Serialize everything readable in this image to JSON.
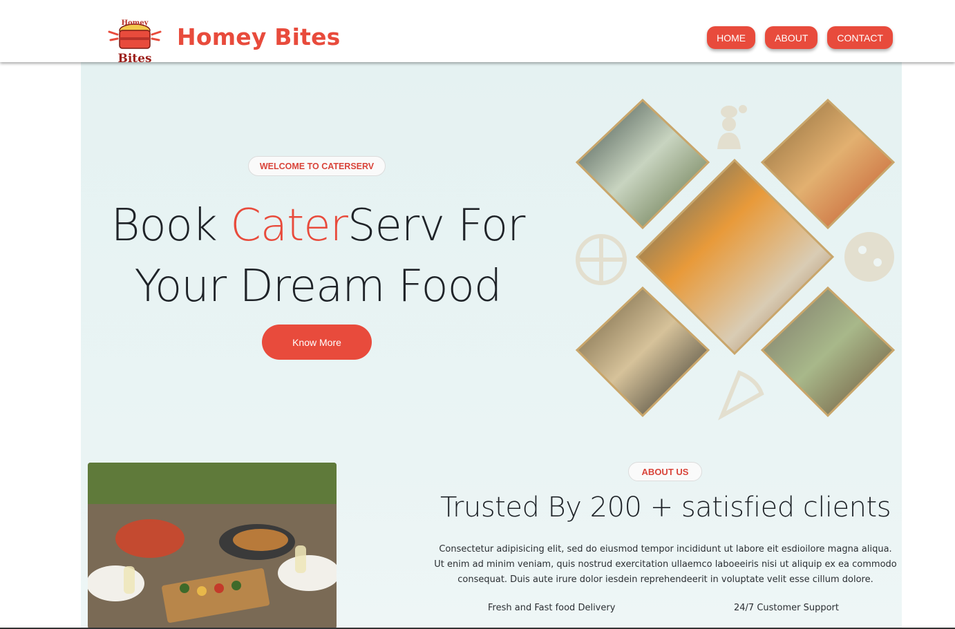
{
  "header": {
    "logo_text_top": "Homey",
    "logo_text_bottom": "Bites",
    "brand": "Homey Bites",
    "nav": [
      "HOME",
      "ABOUT",
      "CONTACT"
    ]
  },
  "hero": {
    "badge": "WELCOME TO CATERSERV",
    "title_part1": "Book ",
    "title_accent": "Cater",
    "title_part2": "Serv For",
    "title_line2": "Your Dream Food",
    "button": "Know More"
  },
  "about": {
    "badge": "ABOUT US",
    "title": "Trusted By 200 + satisfied clients",
    "text": "Consectetur adipisicing elit, sed do eiusmod tempor incididunt ut labore eit esdioilore magna aliqua. Ut enim ad minim veniam, quis nostrud exercitation ullaemco laboeeiris nisi ut aliquip ex ea commodo consequat. Duis aute irure dolor iesdein reprehendeerit in voluptate velit esse cillum dolore.",
    "features": [
      "Fresh and Fast food Delivery",
      "24/7 Customer Support"
    ]
  },
  "colors": {
    "accent": "#e84b3c",
    "panel_bg": "#e5f2f2",
    "tile_border": "#c9a66b"
  },
  "icons": [
    "chef-icon",
    "pizza-icon",
    "pie-icon",
    "pizza-slice-icon"
  ]
}
